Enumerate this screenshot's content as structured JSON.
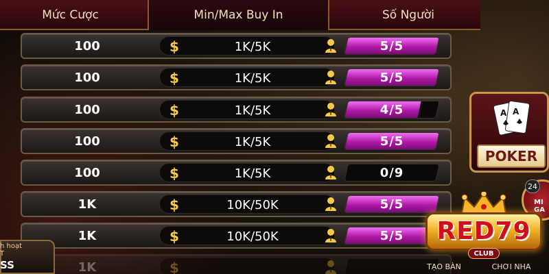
{
  "header": {
    "bet_label": "Mức Cược",
    "buyin_label": "Min/Max Buy In",
    "players_label": "Số Người"
  },
  "rows": [
    {
      "bet": "100",
      "buyin": "1K/5K",
      "players": "5/5",
      "fill": 1.0
    },
    {
      "bet": "100",
      "buyin": "1K/5K",
      "players": "5/5",
      "fill": 1.0
    },
    {
      "bet": "100",
      "buyin": "1K/5K",
      "players": "4/5",
      "fill": 0.8
    },
    {
      "bet": "100",
      "buyin": "1K/5K",
      "players": "5/5",
      "fill": 1.0
    },
    {
      "bet": "100",
      "buyin": "1K/5K",
      "players": "0/9",
      "fill": 0.0
    },
    {
      "bet": "1K",
      "buyin": "10K/50K",
      "players": "5/5",
      "fill": 1.0
    },
    {
      "bet": "1K",
      "buyin": "10K/50K",
      "players": "5/5",
      "fill": 1.0
    },
    {
      "bet": "1K",
      "buyin": "",
      "players": "",
      "fill": 0.0
    }
  ],
  "currency_symbol": "$",
  "side": {
    "poker_label": "POKER",
    "mini_badge": "24",
    "mini_label_line1": "MI",
    "mini_label_line2": "GA"
  },
  "logo": {
    "text": "RED79",
    "sub": "CLUB"
  },
  "bottom": {
    "create_label": "TẠO BÀN",
    "play_label": "CHƠI NHA"
  },
  "left_panel": {
    "title_line1": "h hoạt",
    "title_line2": "T",
    "value": "SS"
  },
  "colors": {
    "accent": "#c21fb8",
    "gold": "#f7c948",
    "header_bg": "#4a0f16"
  }
}
